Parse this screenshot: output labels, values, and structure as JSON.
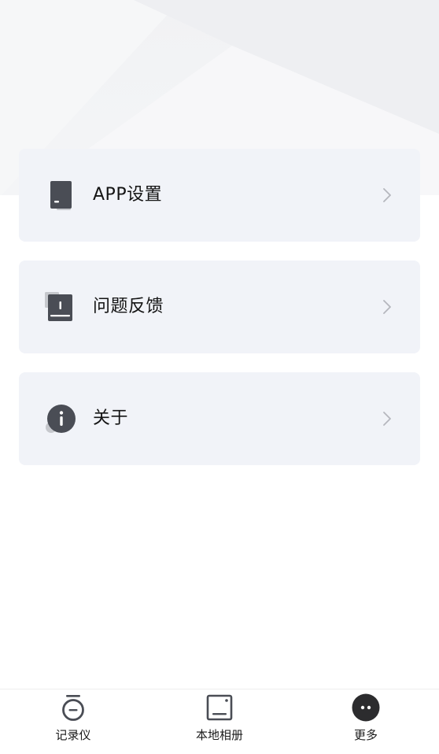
{
  "menu": {
    "items": [
      {
        "label": "APP设置",
        "icon": "app-settings-icon"
      },
      {
        "label": "问题反馈",
        "icon": "feedback-icon"
      },
      {
        "label": "关于",
        "icon": "info-icon"
      }
    ],
    "chevron": "chevron-right-icon"
  },
  "tabbar": {
    "items": [
      {
        "label": "记录仪",
        "icon": "recorder-icon"
      },
      {
        "label": "本地相册",
        "icon": "album-icon"
      },
      {
        "label": "更多",
        "icon": "more-icon",
        "selected": true
      }
    ]
  },
  "colors": {
    "card_background": "#f1f3f8",
    "icon_dark": "#4a4d55",
    "icon_light": "#c6c8cd",
    "chevron": "#b5b7bd"
  }
}
